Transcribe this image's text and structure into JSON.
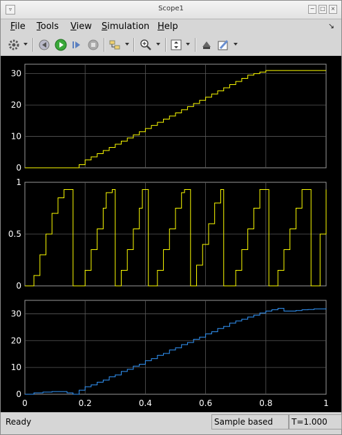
{
  "window": {
    "title": "Scope1"
  },
  "menubar": {
    "items": [
      {
        "label": "File",
        "mnemonic": "F",
        "rest": "ile"
      },
      {
        "label": "Tools",
        "mnemonic": "T",
        "rest": "ools"
      },
      {
        "label": "View",
        "mnemonic": "V",
        "rest": "iew"
      },
      {
        "label": "Simulation",
        "mnemonic": "S",
        "rest": "imulation"
      },
      {
        "label": "Help",
        "mnemonic": "H",
        "rest": "elp"
      }
    ]
  },
  "toolbar": {
    "icons": [
      "gear-icon",
      "step-back-icon",
      "run-icon",
      "step-forward-icon",
      "stop-icon",
      "highlight-block-icon",
      "zoom-in-icon",
      "autoscale-icon",
      "legend-icon",
      "style-icon"
    ]
  },
  "colors": {
    "signal_yellow": "#ffff00",
    "signal_blue": "#3399ff",
    "grid": "#5a5a5a",
    "plot_bg": "#000000"
  },
  "statusbar": {
    "status": "Ready",
    "mode": "Sample based",
    "time": "T=1.000"
  },
  "chart_data": [
    {
      "type": "line",
      "x": [
        0,
        0.18,
        0.2,
        0.22,
        0.24,
        0.26,
        0.28,
        0.3,
        0.32,
        0.34,
        0.36,
        0.38,
        0.4,
        0.42,
        0.44,
        0.46,
        0.48,
        0.5,
        0.52,
        0.54,
        0.56,
        0.58,
        0.6,
        0.62,
        0.64,
        0.66,
        0.68,
        0.7,
        0.72,
        0.74,
        0.76,
        0.78,
        0.8,
        0.82,
        0.84,
        1.0
      ],
      "series": [
        {
          "values": [
            0,
            1,
            2.5,
            3.5,
            4.5,
            5.5,
            6.5,
            7.5,
            8.5,
            9.5,
            10.5,
            11.5,
            12.5,
            13.5,
            14.5,
            15.5,
            16.5,
            17.5,
            18.5,
            19.5,
            20.5,
            21.5,
            22.5,
            23.5,
            24.5,
            25.5,
            26.5,
            27.5,
            28.5,
            29.5,
            30,
            30.5,
            31,
            31,
            31,
            31
          ]
        }
      ],
      "yticks": [
        0,
        10,
        20,
        30
      ],
      "ylim": [
        0,
        33
      ],
      "xlim": [
        0,
        1
      ],
      "grid": true,
      "color": "#ffff00"
    },
    {
      "type": "line",
      "x": [
        0,
        0.03,
        0.05,
        0.07,
        0.09,
        0.11,
        0.13,
        0.14,
        0.16,
        0.2,
        0.22,
        0.24,
        0.26,
        0.27,
        0.29,
        0.3,
        0.32,
        0.34,
        0.36,
        0.38,
        0.39,
        0.41,
        0.44,
        0.46,
        0.48,
        0.5,
        0.52,
        0.53,
        0.55,
        0.57,
        0.59,
        0.61,
        0.63,
        0.65,
        0.66,
        0.7,
        0.72,
        0.74,
        0.76,
        0.78,
        0.79,
        0.81,
        0.84,
        0.86,
        0.88,
        0.9,
        0.92,
        0.93,
        0.95,
        0.98,
        1.0
      ],
      "series": [
        {
          "values": [
            0,
            0.1,
            0.3,
            0.5,
            0.7,
            0.85,
            0.93,
            0.93,
            0,
            0.15,
            0.35,
            0.55,
            0.75,
            0.9,
            0.93,
            0,
            0.15,
            0.35,
            0.55,
            0.75,
            0.93,
            0,
            0.15,
            0.35,
            0.55,
            0.75,
            0.9,
            0.93,
            0,
            0.2,
            0.4,
            0.6,
            0.8,
            0.93,
            0,
            0.15,
            0.35,
            0.55,
            0.75,
            0.93,
            0.93,
            0,
            0.15,
            0.35,
            0.55,
            0.75,
            0.93,
            0.93,
            0,
            0.5,
            0.93
          ]
        }
      ],
      "yticks": [
        0,
        0.5,
        1
      ],
      "ylim": [
        0,
        1
      ],
      "xlim": [
        0,
        1
      ],
      "grid": true,
      "color": "#ffff00"
    },
    {
      "type": "line",
      "x": [
        0,
        0.03,
        0.06,
        0.09,
        0.12,
        0.14,
        0.16,
        0.18,
        0.2,
        0.22,
        0.24,
        0.26,
        0.28,
        0.3,
        0.32,
        0.34,
        0.36,
        0.38,
        0.4,
        0.42,
        0.44,
        0.46,
        0.48,
        0.5,
        0.52,
        0.54,
        0.56,
        0.58,
        0.6,
        0.62,
        0.64,
        0.66,
        0.68,
        0.7,
        0.72,
        0.74,
        0.76,
        0.78,
        0.8,
        0.82,
        0.84,
        0.86,
        0.88,
        0.9,
        0.92,
        0.94,
        0.96,
        1.0
      ],
      "series": [
        {
          "values": [
            0,
            0.5,
            0.8,
            1.0,
            1.0,
            0.5,
            0,
            1.5,
            2.8,
            3.5,
            4.5,
            5.3,
            6.5,
            7.2,
            8.5,
            9.3,
            10.5,
            11.2,
            12.5,
            13.3,
            14.5,
            15.2,
            16.5,
            17.3,
            18.5,
            19.3,
            20.5,
            21.3,
            22.5,
            23.3,
            24.5,
            25.3,
            26.5,
            27.3,
            28.0,
            28.8,
            29.5,
            30.3,
            31.0,
            31.5,
            32.0,
            31.0,
            31.0,
            31.2,
            31.5,
            31.6,
            31.8,
            32.0
          ]
        }
      ],
      "yticks": [
        0,
        10,
        20,
        30
      ],
      "ylim": [
        0,
        35
      ],
      "xlim": [
        0,
        1
      ],
      "xticks": [
        0,
        0.2,
        0.4,
        0.6,
        0.8,
        1
      ],
      "grid": true,
      "color": "#3399ff"
    }
  ]
}
